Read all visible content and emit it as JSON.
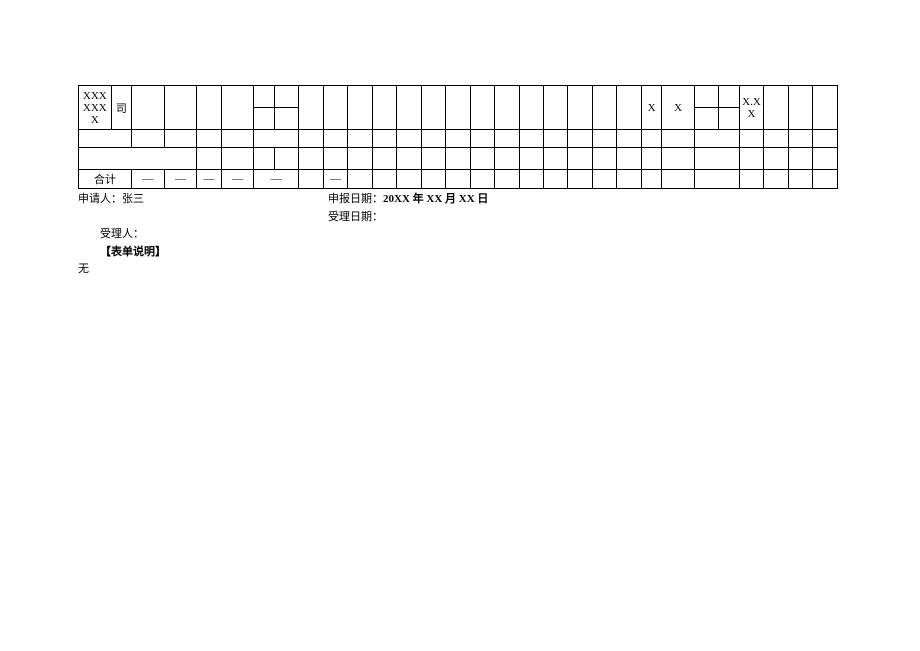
{
  "table": {
    "row1": {
      "c0": "XXX XXX X",
      "c1": "司",
      "c22": "X",
      "c23": "X",
      "c26": "X.X X"
    },
    "row5": {
      "c0": "合计",
      "c1": "—",
      "c2": "—",
      "c3": "—",
      "c4": "—",
      "c5": "—",
      "c7": "—"
    }
  },
  "footer": {
    "applicant_label": "申请人：",
    "applicant_value": "张三",
    "report_date_label": "申报日期：",
    "report_date_value": "20XX 年 XX 月 XX 日",
    "acceptor_label": "受理人：",
    "accept_date_label": "受理日期：",
    "form_note_label": "【表单说明】",
    "form_note_value": "无"
  }
}
